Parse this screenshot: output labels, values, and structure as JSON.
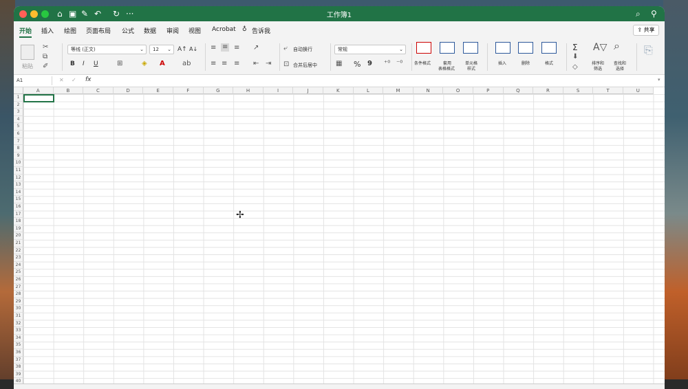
{
  "window": {
    "title": "工作簿1"
  },
  "toolbar": {
    "undo_label": "↶",
    "redo_label": "↻",
    "more_label": "···"
  },
  "menu": {
    "tabs": [
      "开始",
      "插入",
      "绘图",
      "页面布局",
      "公式",
      "数据",
      "审阅",
      "视图",
      "Acrobat"
    ],
    "tell_me": "告诉我",
    "share_label": "共享"
  },
  "ribbon": {
    "paste_label": "粘贴",
    "font_name": "等线 (正文)",
    "font_size": "12",
    "bold": "B",
    "italic": "I",
    "underline": "U",
    "wrap_text": "自动换行",
    "merge_center": "合并后居中",
    "number_format": "常规",
    "percent": "%",
    "comma": "9",
    "conditional_format": "条件格式",
    "table_format_1": "套用",
    "table_format_2": "表格格式",
    "cell_style_1": "单元格",
    "cell_style_2": "样式",
    "insert": "插入",
    "delete": "删除",
    "format": "格式",
    "sort_filter_1": "排序和",
    "sort_filter_2": "筛选",
    "find_select_1": "查找和",
    "find_select_2": "选择",
    "sum": "Σ"
  },
  "formula_bar": {
    "name_box": "A1",
    "fx": "fx",
    "formula": ""
  },
  "columns": [
    "A",
    "B",
    "C",
    "D",
    "E",
    "F",
    "G",
    "H",
    "I",
    "J",
    "K",
    "L",
    "M",
    "N",
    "O",
    "P",
    "Q",
    "R",
    "S",
    "T",
    "U"
  ],
  "rows": [
    "1",
    "2",
    "3",
    "4",
    "5",
    "6",
    "7",
    "8",
    "9",
    "10",
    "11",
    "12",
    "13",
    "14",
    "15",
    "16",
    "17",
    "18",
    "19",
    "20",
    "21",
    "22",
    "23",
    "24",
    "25",
    "26",
    "27",
    "28",
    "29",
    "30",
    "31",
    "32",
    "33",
    "34",
    "35",
    "36",
    "37",
    "38",
    "39",
    "40"
  ],
  "cursor_glyph": "✢",
  "colors": {
    "excel_green": "#217346",
    "ribbon_bg": "#f3f3f3",
    "gridline": "#e3e3e3"
  }
}
